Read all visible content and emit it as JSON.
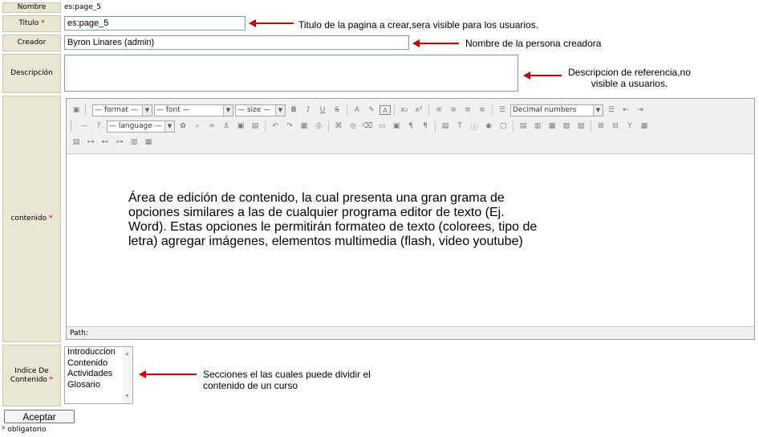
{
  "form": {
    "nombre": {
      "label": "Nombre",
      "value": "es:page_5"
    },
    "titulo": {
      "label": "Titulo",
      "value": "es:page_5"
    },
    "creador": {
      "label": "Creador",
      "value": "Byron Linares (admin)"
    },
    "descripcion": {
      "label": "Descripción",
      "value": ""
    },
    "contenido": {
      "label": "contenido"
    },
    "indice": {
      "label_line1": "Indice De",
      "label_line2": "Contenido",
      "items": [
        "Introduccion",
        "Contenido",
        "Actividades",
        "Glosario"
      ]
    },
    "required_mark": "*",
    "submit_label": "Aceptar",
    "legend_text": "obligatorio"
  },
  "editor": {
    "format_select": "— format —",
    "font_select": "— font —",
    "size_select": "— size —",
    "language_select": "— language —",
    "list_style_select": "Decimal numbers",
    "bold": "B",
    "italic": "I",
    "underline": "U",
    "strike": "S",
    "path_label": "Path:",
    "content_text": "Área de edición de contenido, la cual presenta una gran grama de opciones similares a las de cualquier  programa editor de texto (Ej. Word). Estas opciones le permitirán formateo de texto (colorees, tipo de letra) agregar imágenes, elementos multimedia (flash, video youtube)"
  },
  "annotations": {
    "titulo": "Titulo de la pagina a crear,sera visible para los usuarios.",
    "creador": "Nombre de la persona creadora",
    "descripcion_line1": "Descripcion de referencia,no",
    "descripcion_line2": "visible a usuarios.",
    "indice_line1": "Secciones el las cuales puede dividir el",
    "indice_line2": "contenido de un curso"
  },
  "colors": {
    "label_bg": "#e7e7d4",
    "required": "#cc0000",
    "arrow": "#c00000"
  }
}
